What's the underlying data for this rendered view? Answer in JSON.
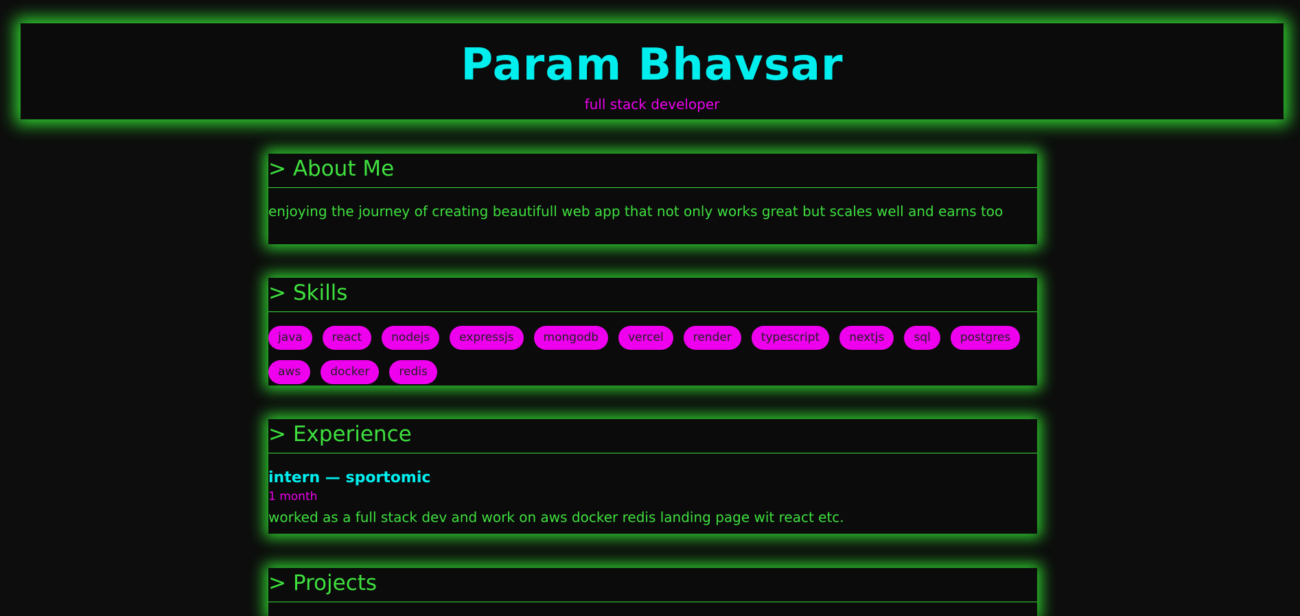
{
  "header": {
    "name": "Param Bhavsar",
    "subtitle": "full stack developer"
  },
  "about": {
    "title": "> About Me",
    "text": "enjoying the journey of creating beautifull web app that not only works great but scales well and earns too"
  },
  "skills": {
    "title": "> Skills",
    "items": [
      "java",
      "react",
      "nodejs",
      "expressjs",
      "mongodb",
      "vercel",
      "render",
      "typescript",
      "nextjs",
      "sql",
      "postgres",
      "aws",
      "docker",
      "redis"
    ]
  },
  "experience": {
    "title": "> Experience",
    "items": [
      {
        "title": "intern — sportomic",
        "duration": "1 month",
        "description": "worked as a full stack dev and work on aws docker redis landing page wit react etc."
      }
    ]
  },
  "projects": {
    "title": "> Projects"
  },
  "colors": {
    "background": "#0d0d0d",
    "glow_green": "#2fd02f",
    "text_green": "#3ee03e",
    "cyan": "#00eeee",
    "magenta": "#ee00ee"
  }
}
